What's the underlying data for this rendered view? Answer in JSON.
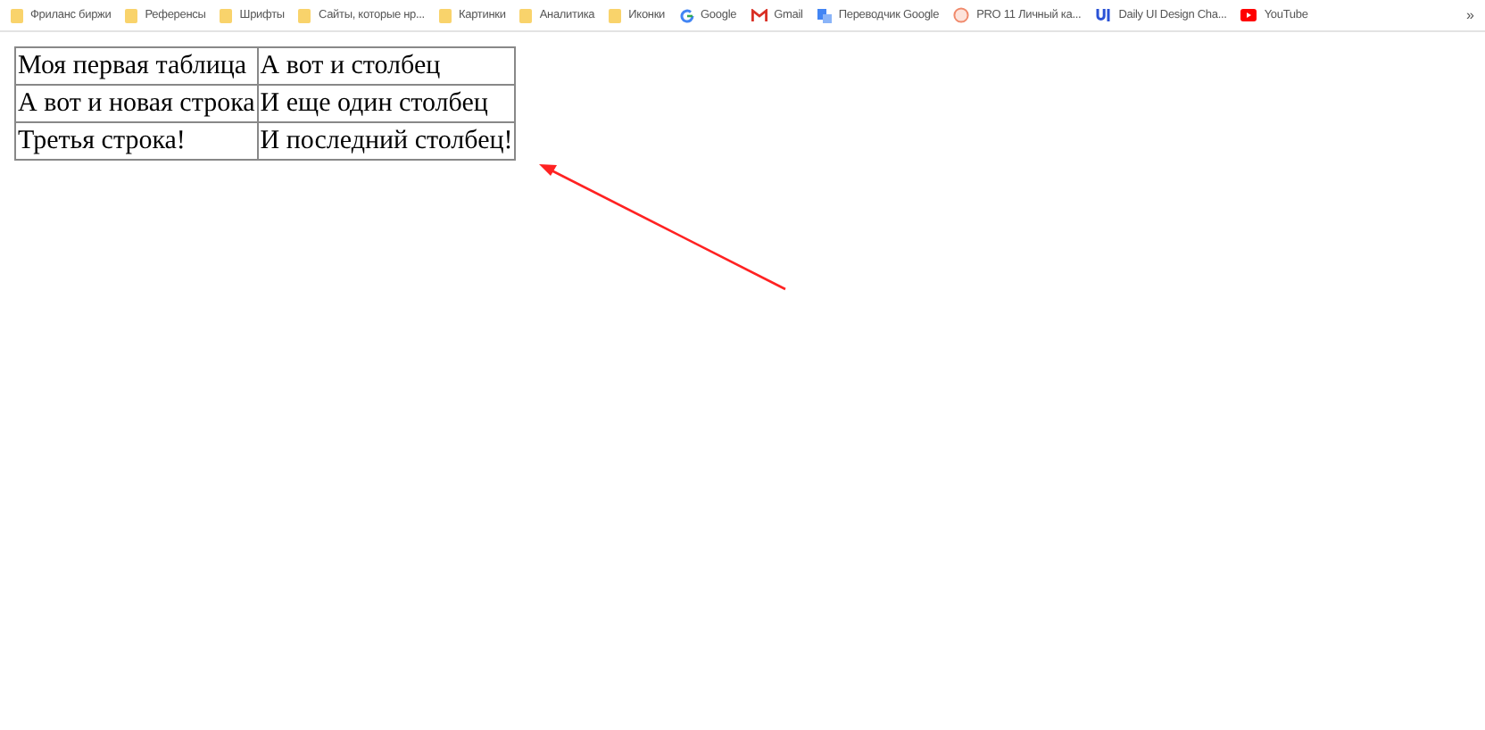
{
  "bookmarks_bar": {
    "items": [
      {
        "kind": "folder",
        "label": "Фриланс биржи"
      },
      {
        "kind": "folder",
        "label": "Референсы"
      },
      {
        "kind": "folder",
        "label": "Шрифты"
      },
      {
        "kind": "folder",
        "label": "Сайты, которые нр..."
      },
      {
        "kind": "folder",
        "label": "Картинки"
      },
      {
        "kind": "folder",
        "label": "Аналитика"
      },
      {
        "kind": "folder",
        "label": "Иконки"
      },
      {
        "kind": "google",
        "label": "Google"
      },
      {
        "kind": "gmail",
        "label": "Gmail"
      },
      {
        "kind": "translate",
        "label": "Переводчик Google"
      },
      {
        "kind": "circle",
        "label": "PRO 11 Личный ка..."
      },
      {
        "kind": "ui",
        "label": "Daily UI Design Cha..."
      },
      {
        "kind": "youtube",
        "label": "YouTube"
      }
    ],
    "overflow": "»"
  },
  "table": {
    "rows": [
      [
        "Моя первая таблица",
        "А вот и столбец"
      ],
      [
        "А вот и новая строка",
        "И еще один столбец"
      ],
      [
        "Третья строка!",
        "И последний столбец!"
      ]
    ]
  }
}
